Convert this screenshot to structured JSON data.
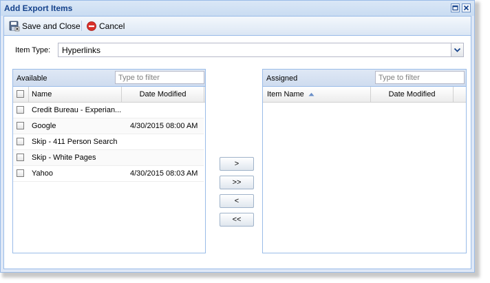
{
  "window": {
    "title": "Add Export Items"
  },
  "toolbar": {
    "save_label": "Save and Close",
    "cancel_label": "Cancel"
  },
  "item_type": {
    "label": "Item Type:",
    "value": "Hyperlinks"
  },
  "available": {
    "title": "Available",
    "filter_placeholder": "Type to filter",
    "columns": {
      "name": "Name",
      "date": "Date Modified"
    },
    "rows": [
      {
        "name": "Credit Bureau - Experian...",
        "date": ""
      },
      {
        "name": "Google",
        "date": "4/30/2015 08:00 AM"
      },
      {
        "name": "Skip - 411 Person Search",
        "date": ""
      },
      {
        "name": "Skip - White Pages",
        "date": ""
      },
      {
        "name": "Yahoo",
        "date": "4/30/2015 08:03 AM"
      }
    ]
  },
  "assigned": {
    "title": "Assigned",
    "filter_placeholder": "Type to filter",
    "columns": {
      "name": "Item Name",
      "date": "Date Modified"
    },
    "rows": []
  },
  "move_buttons": {
    "add": ">",
    "add_all": ">>",
    "remove": "<",
    "remove_all": "<<"
  },
  "icons": {
    "save": "save-close-icon",
    "cancel": "cancel-icon",
    "maximize": "maximize-icon",
    "close": "close-icon",
    "dropdown": "chevron-down-icon",
    "sort": "sort-asc-icon"
  },
  "colors": {
    "title_text": "#15428b",
    "border": "#99bbe8",
    "cancel_red": "#d9302a"
  }
}
